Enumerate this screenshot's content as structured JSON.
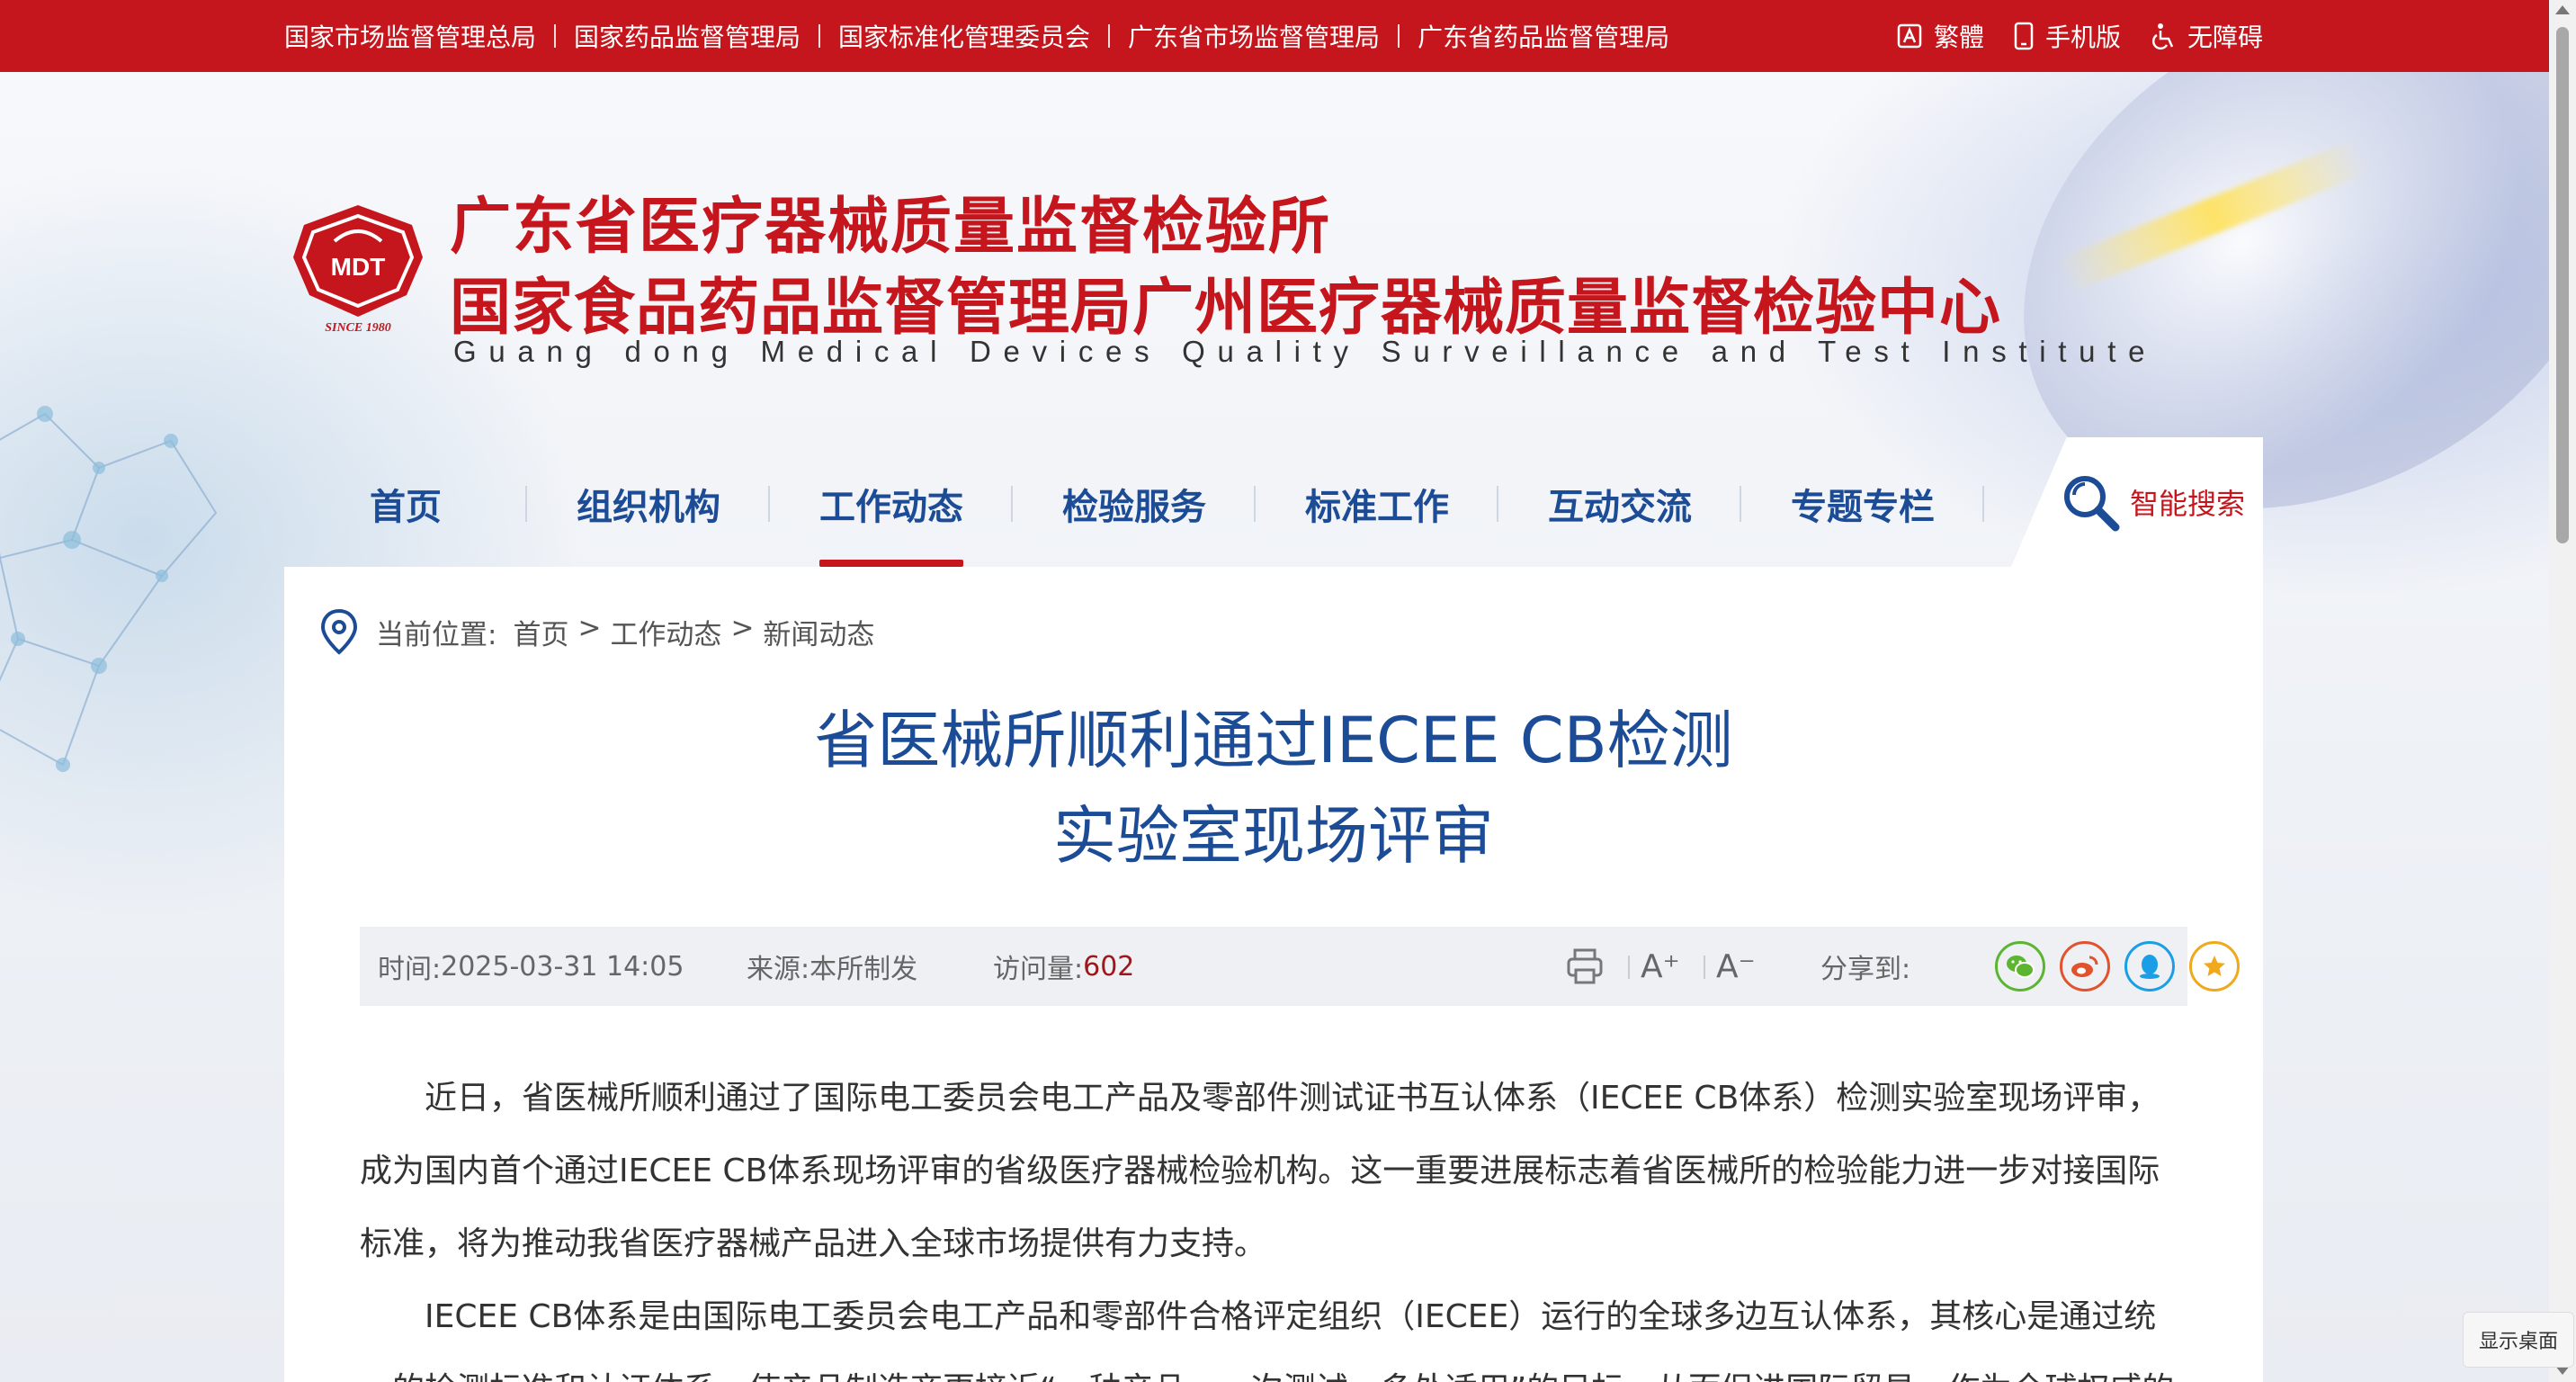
{
  "topbar": {
    "links": [
      "国家市场监督管理总局",
      "国家药品监督管理局",
      "国家标准化管理委员会",
      "广东省市场监督管理局",
      "广东省药品监督管理局"
    ],
    "traditional": "繁體",
    "mobile": "手机版",
    "accessibility": "无障碍"
  },
  "header": {
    "title_cn_1": "广东省医疗器械质量监督检验所",
    "title_cn_2": "国家食品药品监督管理局广州医疗器械质量监督检验中心",
    "title_en": "Guang dong Medical Devices Quality Surveillance and Test Institute",
    "logo_text": "MDT",
    "logo_since": "SINCE 1980"
  },
  "nav": {
    "items": [
      "首页",
      "组织机构",
      "工作动态",
      "检验服务",
      "标准工作",
      "互动交流",
      "专题专栏"
    ],
    "active_index": 2,
    "search_label": "智能搜索"
  },
  "breadcrumb": {
    "label": "当前位置:",
    "items": [
      "首页",
      ">",
      "工作动态",
      ">",
      "新闻动态"
    ]
  },
  "article": {
    "title_line1": "省医械所顺利通过IECEE CB检测",
    "title_line2": "实验室现场评审",
    "time_label": "时间:",
    "time_value": "2025-03-31 14:05",
    "source_label": "来源:",
    "source_value": "本所制发",
    "visits_label": "访问量:",
    "visits_value": "602",
    "font_increase": "A⁺",
    "font_decrease": "A⁻",
    "share_label": "分享到:",
    "paragraph1": "近日，省医械所顺利通过了国际电工委员会电工产品及零部件测试证书互认体系（IECEE CB体系）检测实验室现场评审，成为国内首个通过IECEE CB体系现场评审的省级医疗器械检验机构。这一重要进展标志着省医械所的检验能力进一步对接国际标准，将为推动我省医疗器械产品进入全球市场提供有力支持。",
    "paragraph2": "IECEE CB体系是由国际电工委员会电工产品和零部件合格评定组织（IECEE）运行的全球多边互认体系，其核心是通过统一的检测标准和认证体系，使产品制造商更接近“一种产品、一次测试、多处适用”的目标，从而促进国际贸易，作为全球权威的"
  },
  "system": {
    "show_desktop": "显示桌面"
  },
  "colors": {
    "brand_red": "#c4161c",
    "nav_blue": "#1d4c97",
    "visits_red": "#a0161b"
  }
}
